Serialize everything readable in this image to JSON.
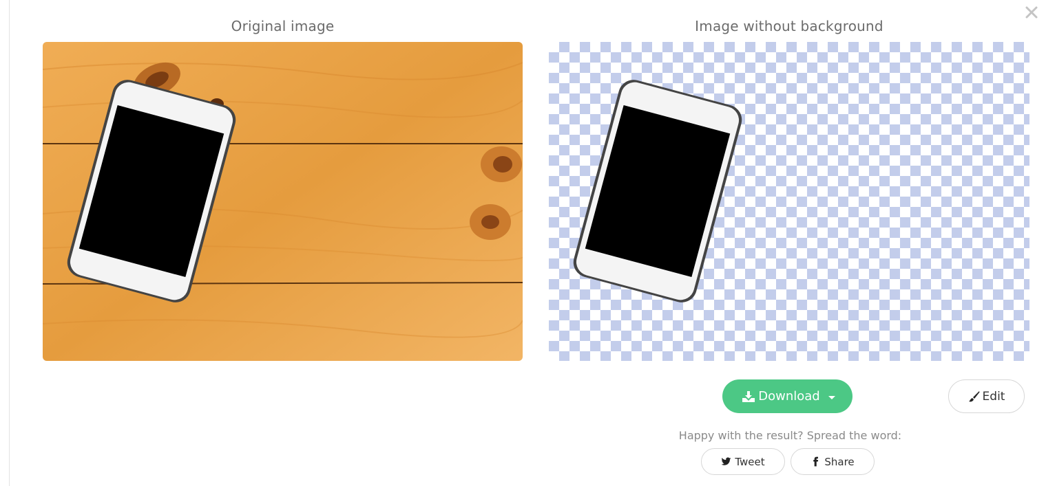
{
  "captions": {
    "original": "Original image",
    "result": "Image without background"
  },
  "icons": {
    "close": "close-icon",
    "download": "download-icon",
    "dropdown": "caret-down-icon",
    "edit": "brush-icon",
    "twitter": "twitter-icon",
    "facebook": "facebook-icon"
  },
  "actions": {
    "download_label": "Download",
    "edit_label": "Edit"
  },
  "share": {
    "prompt": "Happy with the result? Spread the word:",
    "tweet_label": "Tweet",
    "share_label": "Share"
  },
  "colors": {
    "accent_green": "#4cc885",
    "checker_blue": "#c3cdeb",
    "wood": "#e8a54a"
  }
}
